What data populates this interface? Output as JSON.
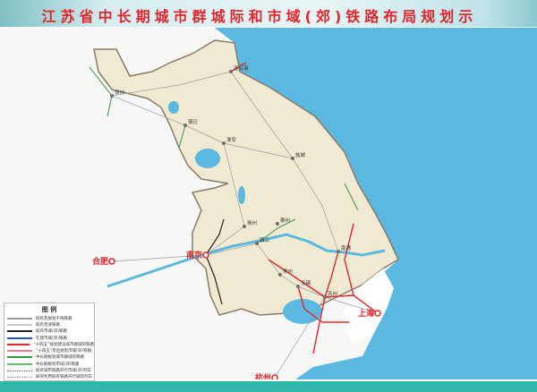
{
  "title": "江苏省中长期城市群城际和市域(郊)铁路布局规划示意图",
  "colors": {
    "sea": "#5bb8e0",
    "province": "#f1ead2",
    "outside": "#f7f7f5",
    "lake": "#5bb8e0",
    "intercity": "#e0262c",
    "suburban": "#2e9a4a",
    "existing_suburban": "#222222",
    "banner_title": "#e0262c",
    "footer": "#2fb7ac"
  },
  "cities": [
    {
      "name": "南京",
      "capital": true
    },
    {
      "name": "上海",
      "capital": true
    },
    {
      "name": "杭州",
      "capital": true
    },
    {
      "name": "合肥",
      "capital": true
    },
    {
      "name": "徐州"
    },
    {
      "name": "连云港"
    },
    {
      "name": "宿迁"
    },
    {
      "name": "淮安"
    },
    {
      "name": "盐城"
    },
    {
      "name": "扬州"
    },
    {
      "name": "泰州"
    },
    {
      "name": "镇江"
    },
    {
      "name": "常州"
    },
    {
      "name": "无锡"
    },
    {
      "name": "苏州"
    },
    {
      "name": "南通"
    }
  ],
  "legend": {
    "title": "图 例",
    "items": [
      {
        "label": "既有及规划干线铁路",
        "color": "#9a9aa8",
        "style": "solid"
      },
      {
        "label": "既有普速铁路",
        "color": "#c8c8d8",
        "style": "solid"
      },
      {
        "label": "既有市域(郊)铁路",
        "color": "#222222",
        "style": "solid"
      },
      {
        "label": "在建市域(郊)铁路",
        "color": "#2850c8",
        "style": "solid"
      },
      {
        "label": "“十四五”规划建设城市群城际铁路",
        "color": "#e0262c",
        "style": "solid"
      },
      {
        "label": "“十四五”及后规划市域(郊)铁路",
        "color": "#f08090",
        "style": "solid"
      },
      {
        "label": "中长期规划城市群城际铁路",
        "color": "#2e9a4a",
        "style": "solid"
      },
      {
        "label": "中长期规划市域(郊)铁路",
        "color": "#5cc070",
        "style": "solid"
      },
      {
        "label": "既有城市铁路开行市域(郊)列车",
        "color": "#e0262c",
        "style": "dotted"
      },
      {
        "label": "研究利用既有铁路开行城际列车",
        "color": "#2fb7ac",
        "style": "dotted"
      }
    ]
  }
}
